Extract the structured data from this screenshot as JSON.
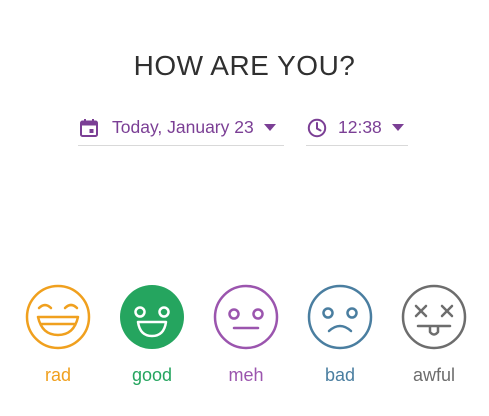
{
  "header": {
    "title": "HOW ARE YOU?"
  },
  "date_picker": {
    "label": "Today, January 23",
    "icon": "calendar-icon"
  },
  "time_picker": {
    "label": "12:38",
    "icon": "clock-icon"
  },
  "accent_color": "#7b3f95",
  "moods": [
    {
      "label": "rad",
      "color": "#f0a01e",
      "icon": "rad-face-icon"
    },
    {
      "label": "good",
      "color": "#25a55f",
      "icon": "good-face-icon",
      "selected": true
    },
    {
      "label": "meh",
      "color": "#9b55ae",
      "icon": "meh-face-icon"
    },
    {
      "label": "bad",
      "color": "#4a7ea0",
      "icon": "bad-face-icon"
    },
    {
      "label": "awful",
      "color": "#6d6d6d",
      "icon": "awful-face-icon"
    }
  ]
}
